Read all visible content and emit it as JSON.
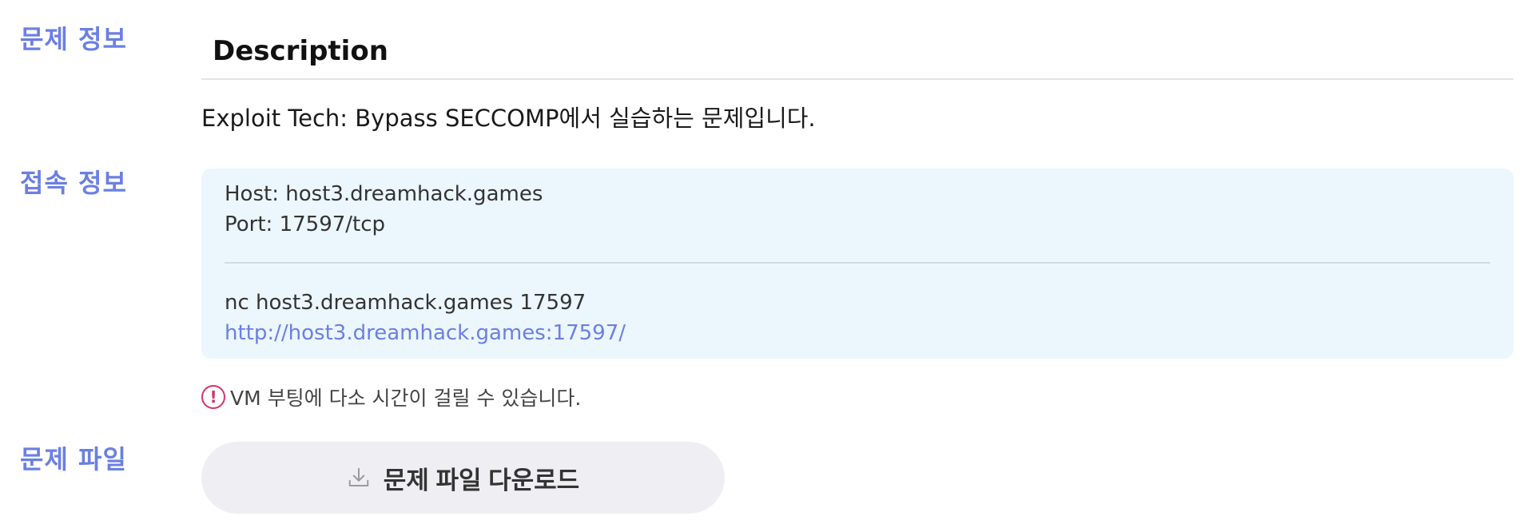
{
  "sections": {
    "problem_info": "문제 정보",
    "connection_info": "접속 정보",
    "problem_file": "문제 파일"
  },
  "description": {
    "heading": "Description",
    "text": "Exploit Tech: Bypass SECCOMP에서 실습하는 문제입니다."
  },
  "connection": {
    "host": "Host: host3.dreamhack.games",
    "port": "Port: 17597/tcp",
    "nc_command": "nc host3.dreamhack.games 17597",
    "url": "http://host3.dreamhack.games:17597/"
  },
  "warning": {
    "icon": "exclamation-circle-icon",
    "text": "VM 부팅에 다소 시간이 걸릴 수 있습니다."
  },
  "download": {
    "icon": "download-icon",
    "label": "문제 파일 다운로드"
  },
  "colors": {
    "accent": "#6b7fe3",
    "info_box_bg": "#ecf6fd",
    "warning": "#d6336c",
    "button_bg": "#efeff3"
  }
}
